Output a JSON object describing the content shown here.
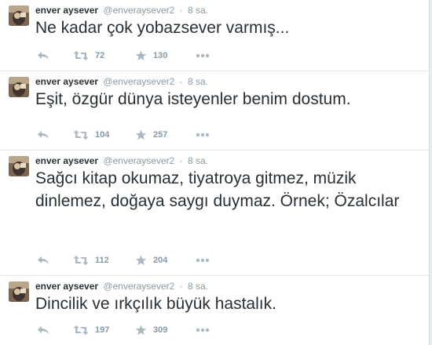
{
  "tweets": [
    {
      "author": {
        "name": "enver aysever",
        "handle": "@enveraysever2"
      },
      "time": "8 sa.",
      "text": "Ne kadar çok yobazsever varmış...",
      "retweets": "72",
      "favorites": "130"
    },
    {
      "author": {
        "name": "enver aysever",
        "handle": "@enveraysever2"
      },
      "time": "8 sa.",
      "text": "Eşit, özgür dünya isteyenler benim dostum.",
      "retweets": "104",
      "favorites": "257"
    },
    {
      "author": {
        "name": "enver aysever",
        "handle": "@enveraysever2"
      },
      "time": "8 sa.",
      "text": "Sağcı kitap okumaz, tiyatroya gitmez, müzik dinlemez, doğaya saygı duymaz. Örnek; Özalcılar",
      "retweets": "112",
      "favorites": "204"
    },
    {
      "author": {
        "name": "enver aysever",
        "handle": "@enveraysever2"
      },
      "time": "8 sa.",
      "text": "Dincilik ve ırkçılık büyük hastalık.",
      "retweets": "197",
      "favorites": "309"
    }
  ],
  "icons": {
    "reply": "reply-icon",
    "retweet": "retweet-icon",
    "favorite": "star-icon",
    "more": "more-icon"
  },
  "colors": {
    "text": "#292f33",
    "muted": "#8899a6",
    "icon": "#aab8c2",
    "divider": "#e1e8ed"
  }
}
